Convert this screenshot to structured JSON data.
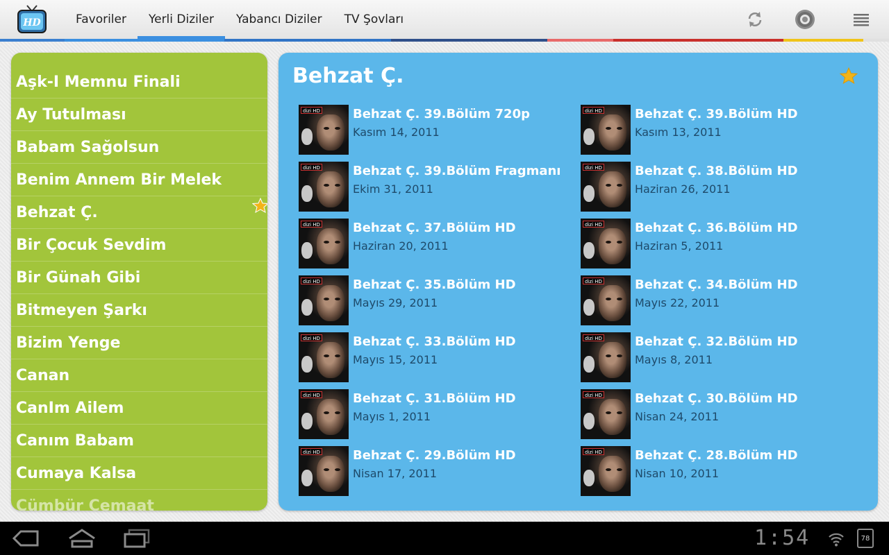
{
  "app": {
    "logo_label": "HD"
  },
  "tabs": [
    {
      "label": "Favoriler",
      "active": false
    },
    {
      "label": "Yerli Diziler",
      "active": true
    },
    {
      "label": "Yabancı Diziler",
      "active": false
    },
    {
      "label": "TV Şovları",
      "active": false
    }
  ],
  "actions": {
    "refresh_icon": "refresh-icon",
    "settings_icon": "gear-icon",
    "menu_icon": "menu-icon"
  },
  "series_list": [
    {
      "label": "Aşk-I Memnu Finali"
    },
    {
      "label": "Ay Tutulması"
    },
    {
      "label": "Babam Sağolsun"
    },
    {
      "label": "Benim Annem Bir Melek"
    },
    {
      "label": "Behzat Ç.",
      "selected": true
    },
    {
      "label": "Bir Çocuk Sevdim"
    },
    {
      "label": "Bir Günah Gibi"
    },
    {
      "label": "Bitmeyen Şarkı"
    },
    {
      "label": "Bizim Yenge"
    },
    {
      "label": "Canan"
    },
    {
      "label": "CanIm Ailem"
    },
    {
      "label": "Canım Babam"
    },
    {
      "label": "Cumaya Kalsa"
    },
    {
      "label": "Cümbür Cemaat"
    }
  ],
  "detail": {
    "title": "Behzat Ç.",
    "thumb_badge": "dizi HD",
    "episodes": [
      {
        "title": "Behzat Ç. 39.Bölüm 720p",
        "date": "Kasım 14, 2011"
      },
      {
        "title": "Behzat Ç. 39.Bölüm  HD",
        "date": "Kasım 13, 2011"
      },
      {
        "title": "Behzat Ç. 39.Bölüm Fragmanı",
        "date": "Ekim 31, 2011"
      },
      {
        "title": "Behzat Ç. 38.Bölüm  HD",
        "date": "Haziran 26, 2011"
      },
      {
        "title": "Behzat Ç. 37.Bölüm  HD",
        "date": "Haziran 20, 2011"
      },
      {
        "title": "Behzat Ç. 36.Bölüm  HD",
        "date": "Haziran 5, 2011"
      },
      {
        "title": "Behzat Ç. 35.Bölüm  HD",
        "date": "Mayıs 29, 2011"
      },
      {
        "title": "Behzat Ç. 34.Bölüm  HD",
        "date": "Mayıs 22, 2011"
      },
      {
        "title": "Behzat Ç. 33.Bölüm  HD",
        "date": "Mayıs 15, 2011"
      },
      {
        "title": "Behzat Ç. 32.Bölüm  HD",
        "date": "Mayıs 8, 2011"
      },
      {
        "title": "Behzat Ç. 31.Bölüm  HD",
        "date": "Mayıs 1, 2011"
      },
      {
        "title": "Behzat Ç. 30.Bölüm  HD",
        "date": "Nisan 24, 2011"
      },
      {
        "title": "Behzat Ç. 29.Bölüm  HD",
        "date": "Nisan 17, 2011"
      },
      {
        "title": "Behzat Ç. 28.Bölüm  HD",
        "date": "Nisan 10, 2011"
      }
    ]
  },
  "colors": {
    "list_panel": "#a2c53b",
    "detail_panel": "#5bb7ea",
    "tab_indicator": "#3b8fe0",
    "star": "#f2b418"
  },
  "systembar": {
    "clock": "1:54",
    "battery": "78"
  }
}
